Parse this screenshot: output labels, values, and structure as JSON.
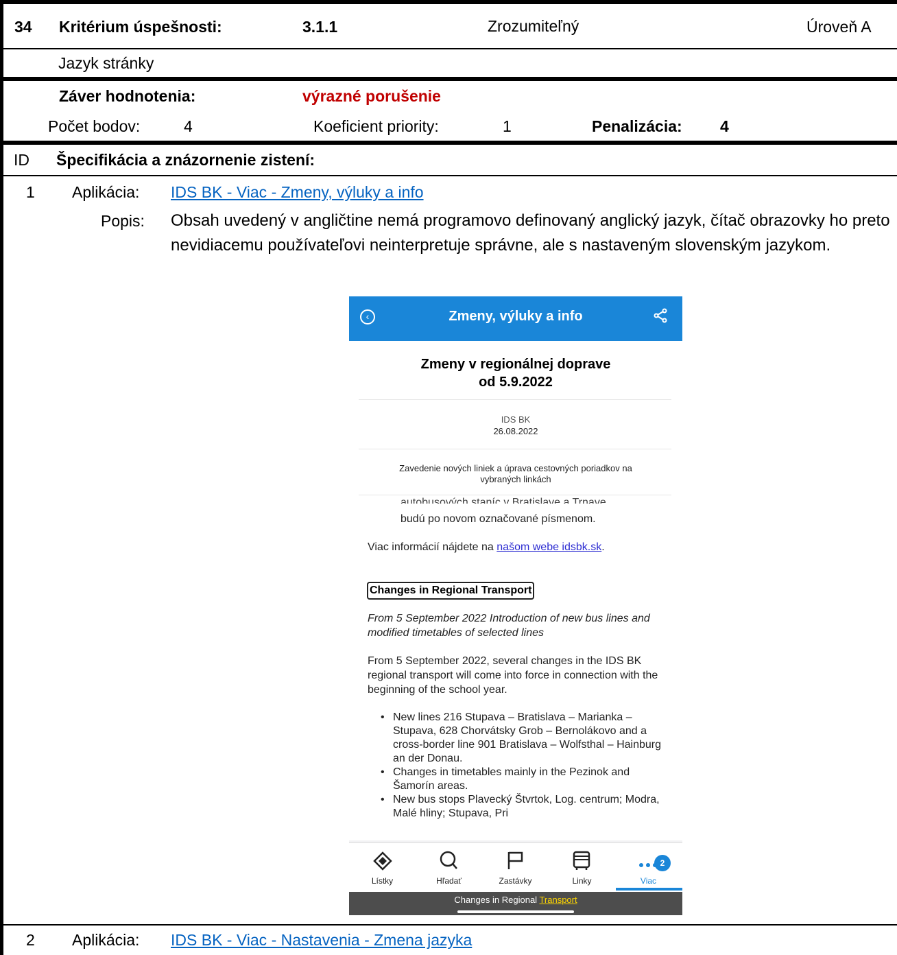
{
  "header": {
    "number": "34",
    "criterion_label": "Kritérium úspešnosti:",
    "criterion_id": "3.1.1",
    "principle": "Zrozumiteľný",
    "level": "Úroveň A",
    "criterion_name": "Jazyk stránky"
  },
  "evaluation": {
    "conclusion_label": "Záver hodnotenia:",
    "conclusion_value": "výrazné porušenie",
    "points_label": "Počet bodov:",
    "points_value": "4",
    "priority_label": "Koeficient priority:",
    "priority_value": "1",
    "penalty_label": "Penalizácia:",
    "penalty_value": "4"
  },
  "findings": {
    "id_header": "ID",
    "title": "Špecifikácia a znázornenie zistení:",
    "app_label": "Aplikácia:",
    "desc_label": "Popis:",
    "items": [
      {
        "id": "1",
        "app_link": "IDS BK - Viac - Zmeny, výluky a info",
        "description": "Obsah uvedený v angličtine nemá programovo definovaný anglický jazyk, čítač obrazovky ho preto nevidiacemu používateľovi neinterpretuje správne, ale s nastaveným slovenským jazykom."
      },
      {
        "id": "2",
        "app_link": "IDS BK - Viac - Nastavenia - Zmena jazyka"
      }
    ]
  },
  "phone": {
    "title": "Zmeny, výluky a info",
    "article_title_1": "Zmeny v regionálnej doprave",
    "article_title_2": "od 5.9.2022",
    "source": "IDS BK",
    "date": "26.08.2022",
    "subtitle_1": "Zavedenie nových liniek a úprava cestovných poriadkov na",
    "subtitle_2": "vybraných linkách",
    "cut_line": "autobusových staníc v Bratislave a Trnave",
    "sk_text": "budú po novom označované písmenom.",
    "more_info_prefix": "Viac informácií nájdete na ",
    "more_info_link": "našom webe idsbk.sk",
    "more_info_suffix": ".",
    "en_heading": "Changes in Regional Transport",
    "en_intro": "From 5 September 2022 Introduction of new bus lines and modified timetables of selected lines",
    "en_para": "From 5 September 2022, several changes in the IDS BK regional transport will come into force in connection with the beginning of the school year.",
    "en_bullets": [
      "New lines 216 Stupava – Bratislava – Marianka – Stupava, 628 Chorvátsky Grob – Bernolákovo and a cross-border line 901 Bratislava – Wolfsthal – Hainburg an der Donau.",
      "Changes in timetables mainly in the Pezinok and Šamorín areas.",
      "New bus stops Plavecký Štvrtok, Log. centrum; Modra, Malé hliny; Stupava, Pri"
    ],
    "tabs": [
      {
        "label": "Lístky",
        "icon": "ticket-icon"
      },
      {
        "label": "Hľadať",
        "icon": "search-icon"
      },
      {
        "label": "Zastávky",
        "icon": "flag-icon"
      },
      {
        "label": "Linky",
        "icon": "bus-icon"
      },
      {
        "label": "Viac",
        "icon": "more-icon"
      }
    ],
    "badge": "2",
    "caption_prefix": "Changes in Regional ",
    "caption_highlight": "Transport",
    "accent_color": "#1a86d8"
  }
}
